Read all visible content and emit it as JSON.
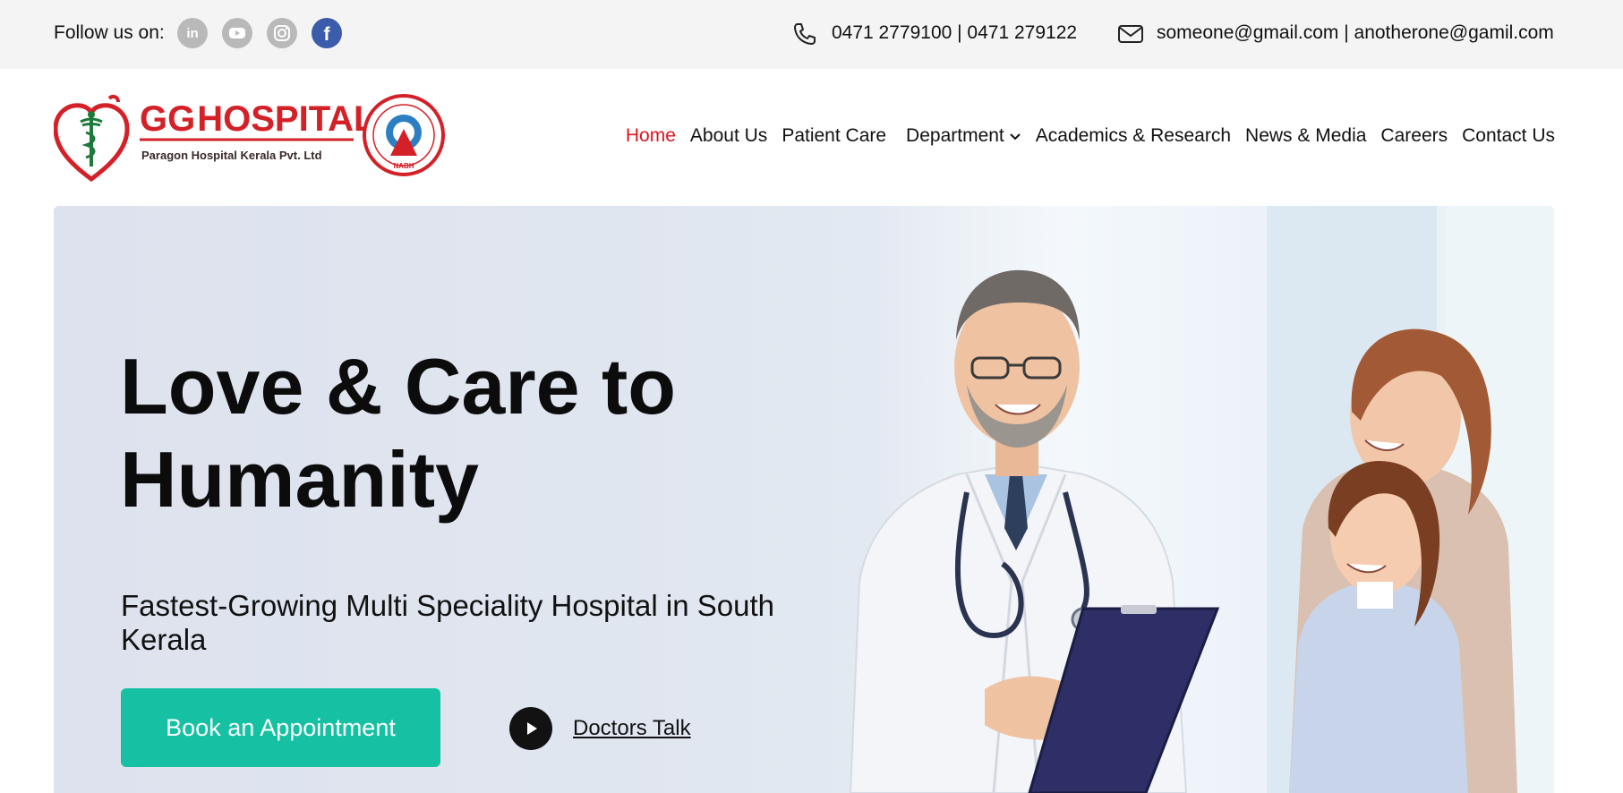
{
  "topbar": {
    "follow_label": "Follow us on:",
    "social": [
      {
        "icon": "linkedin-icon",
        "label": "in"
      },
      {
        "icon": "youtube-icon"
      },
      {
        "icon": "instagram-icon"
      },
      {
        "icon": "facebook-icon",
        "label": "f"
      }
    ],
    "phone": "0471 2779100 | 0471 279122",
    "email": "someone@gmail.com | anotherone@gamil.com"
  },
  "logo": {
    "title": "GG HOSPITAL",
    "title_g": "GG",
    "title_rest": "HOSPITAL",
    "subtitle": "Paragon Hospital Kerala Pvt. Ltd",
    "badge": "NABH"
  },
  "nav": {
    "items": [
      {
        "label": "Home",
        "active": true
      },
      {
        "label": "About Us"
      },
      {
        "label": "Patient Care"
      },
      {
        "label": "Department",
        "has_dropdown": true
      },
      {
        "label": "Academics & Research"
      },
      {
        "label": "News & Media"
      },
      {
        "label": "Careers"
      },
      {
        "label": "Contact Us"
      }
    ]
  },
  "hero": {
    "title": "Love & Care to Humanity",
    "subtitle": "Fastest-Growing Multi Speciality Hospital in South Kerala",
    "cta_label": "Book an Appointment",
    "video_label": "Doctors Talk"
  },
  "colors": {
    "accent_red": "#e0141e",
    "cta_teal": "#16c1a3",
    "facebook_blue": "#3b5bab",
    "topbar_bg": "#f4f4f4"
  }
}
